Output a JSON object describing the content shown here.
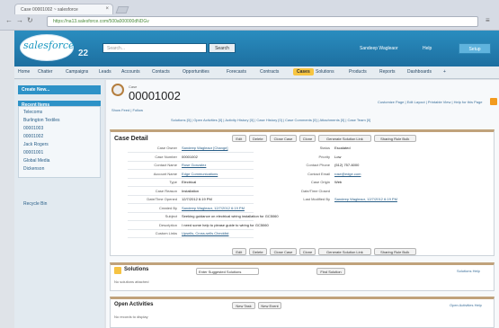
{
  "browser": {
    "tab_title": "Case 00001002 ~ salesforce",
    "url": "https://na13.salesforce.com/500a000000dNDGv"
  },
  "header": {
    "logo_text": "salesforce",
    "release_badge": "22",
    "search_placeholder": "Search...",
    "search_button": "Search",
    "user_menu": "Sandeep Wagleaor",
    "help_link": "Help",
    "setup_button": "Setup"
  },
  "tabs": [
    "Home",
    "Chatter",
    "Campaigns",
    "Leads",
    "Accounts",
    "Contacts",
    "Opportunities",
    "Forecasts",
    "Contracts",
    "Cases",
    "Solutions",
    "Products",
    "Reports",
    "Dashboards",
    "+"
  ],
  "active_tab": "Cases",
  "sidebar": {
    "create_new": "Create New...",
    "recent_items_label": "Recent Items",
    "items": [
      "Telecoms",
      "Burlington Textiles",
      "00001003",
      "00001002",
      "Jack Rogers",
      "00001001",
      "Global Media",
      "Dickenson"
    ],
    "recycle_bin": "Recycle Bin"
  },
  "page": {
    "object_label": "Case",
    "case_number": "00001002",
    "help_link": "Customize Page | Edit Layout | Printable View | Help for this Page",
    "links": "Show Feed | Follow",
    "related_links": "Solutions [0] | Open Activities [0] | Activity History [0] | Case History [0] | Case Comments [0] | Attachments [0] | Case Team [0]"
  },
  "detail": {
    "title": "Case Detail",
    "buttons": [
      "Edit",
      "Delete",
      "Close Case",
      "Clone",
      "Generate Solution Link",
      "Sharing Rule Bulk"
    ],
    "left": [
      {
        "label": "Case Owner",
        "value": "Sandeep Wagleaor [Change]",
        "link": true
      },
      {
        "label": "Case Number",
        "value": "00001002",
        "link": false
      },
      {
        "label": "Contact Name",
        "value": "Rose Gonzalez",
        "link": true
      },
      {
        "label": "Account Name",
        "value": "Edge Communications",
        "link": true
      },
      {
        "label": "Type",
        "value": "Electrical",
        "link": false
      },
      {
        "label": "Case Reason",
        "value": "Installation",
        "link": false
      },
      {
        "label": "Date/Time Opened",
        "value": "12/7/2012 6:19 PM",
        "link": false
      },
      {
        "label": "Created By",
        "value": "Sandeep Wagleaor, 12/7/2012 6:19 PM",
        "link": true
      },
      {
        "label": "Subject",
        "value": "Seeking guidance on electrical wiring installation for GC5060",
        "link": false
      },
      {
        "label": "Description",
        "value": "I need some help to please guide to wiring for GC5060",
        "link": false
      },
      {
        "label": "Custom Links",
        "value": "Upsells, Cross-sells Checklist",
        "link": true
      }
    ],
    "right": [
      {
        "label": "Status",
        "value": "Escalated",
        "link": false
      },
      {
        "label": "Priority",
        "value": "Low",
        "link": false
      },
      {
        "label": "Contact Phone",
        "value": "(512) 757-6000",
        "link": false
      },
      {
        "label": "Contact Email",
        "value": "rose@edge.com",
        "link": true
      },
      {
        "label": "Case Origin",
        "value": "Web",
        "link": false
      },
      {
        "label": "Date/Time Closed",
        "value": "",
        "link": false
      },
      {
        "label": "Last Modified By",
        "value": "Sandeep Wagleaor, 12/7/2012 6:19 PM",
        "link": true
      }
    ]
  },
  "solutions": {
    "title": "Solutions",
    "search_placeholder": "Enter Suggested Solutions",
    "find_button": "Find Solution",
    "help": "Solutions Help",
    "none": "No solutions attached"
  },
  "activities": {
    "title": "Open Activities",
    "buttons": [
      "New Task",
      "New Event"
    ],
    "help": "Open Activities Help",
    "none": "No records to display"
  }
}
